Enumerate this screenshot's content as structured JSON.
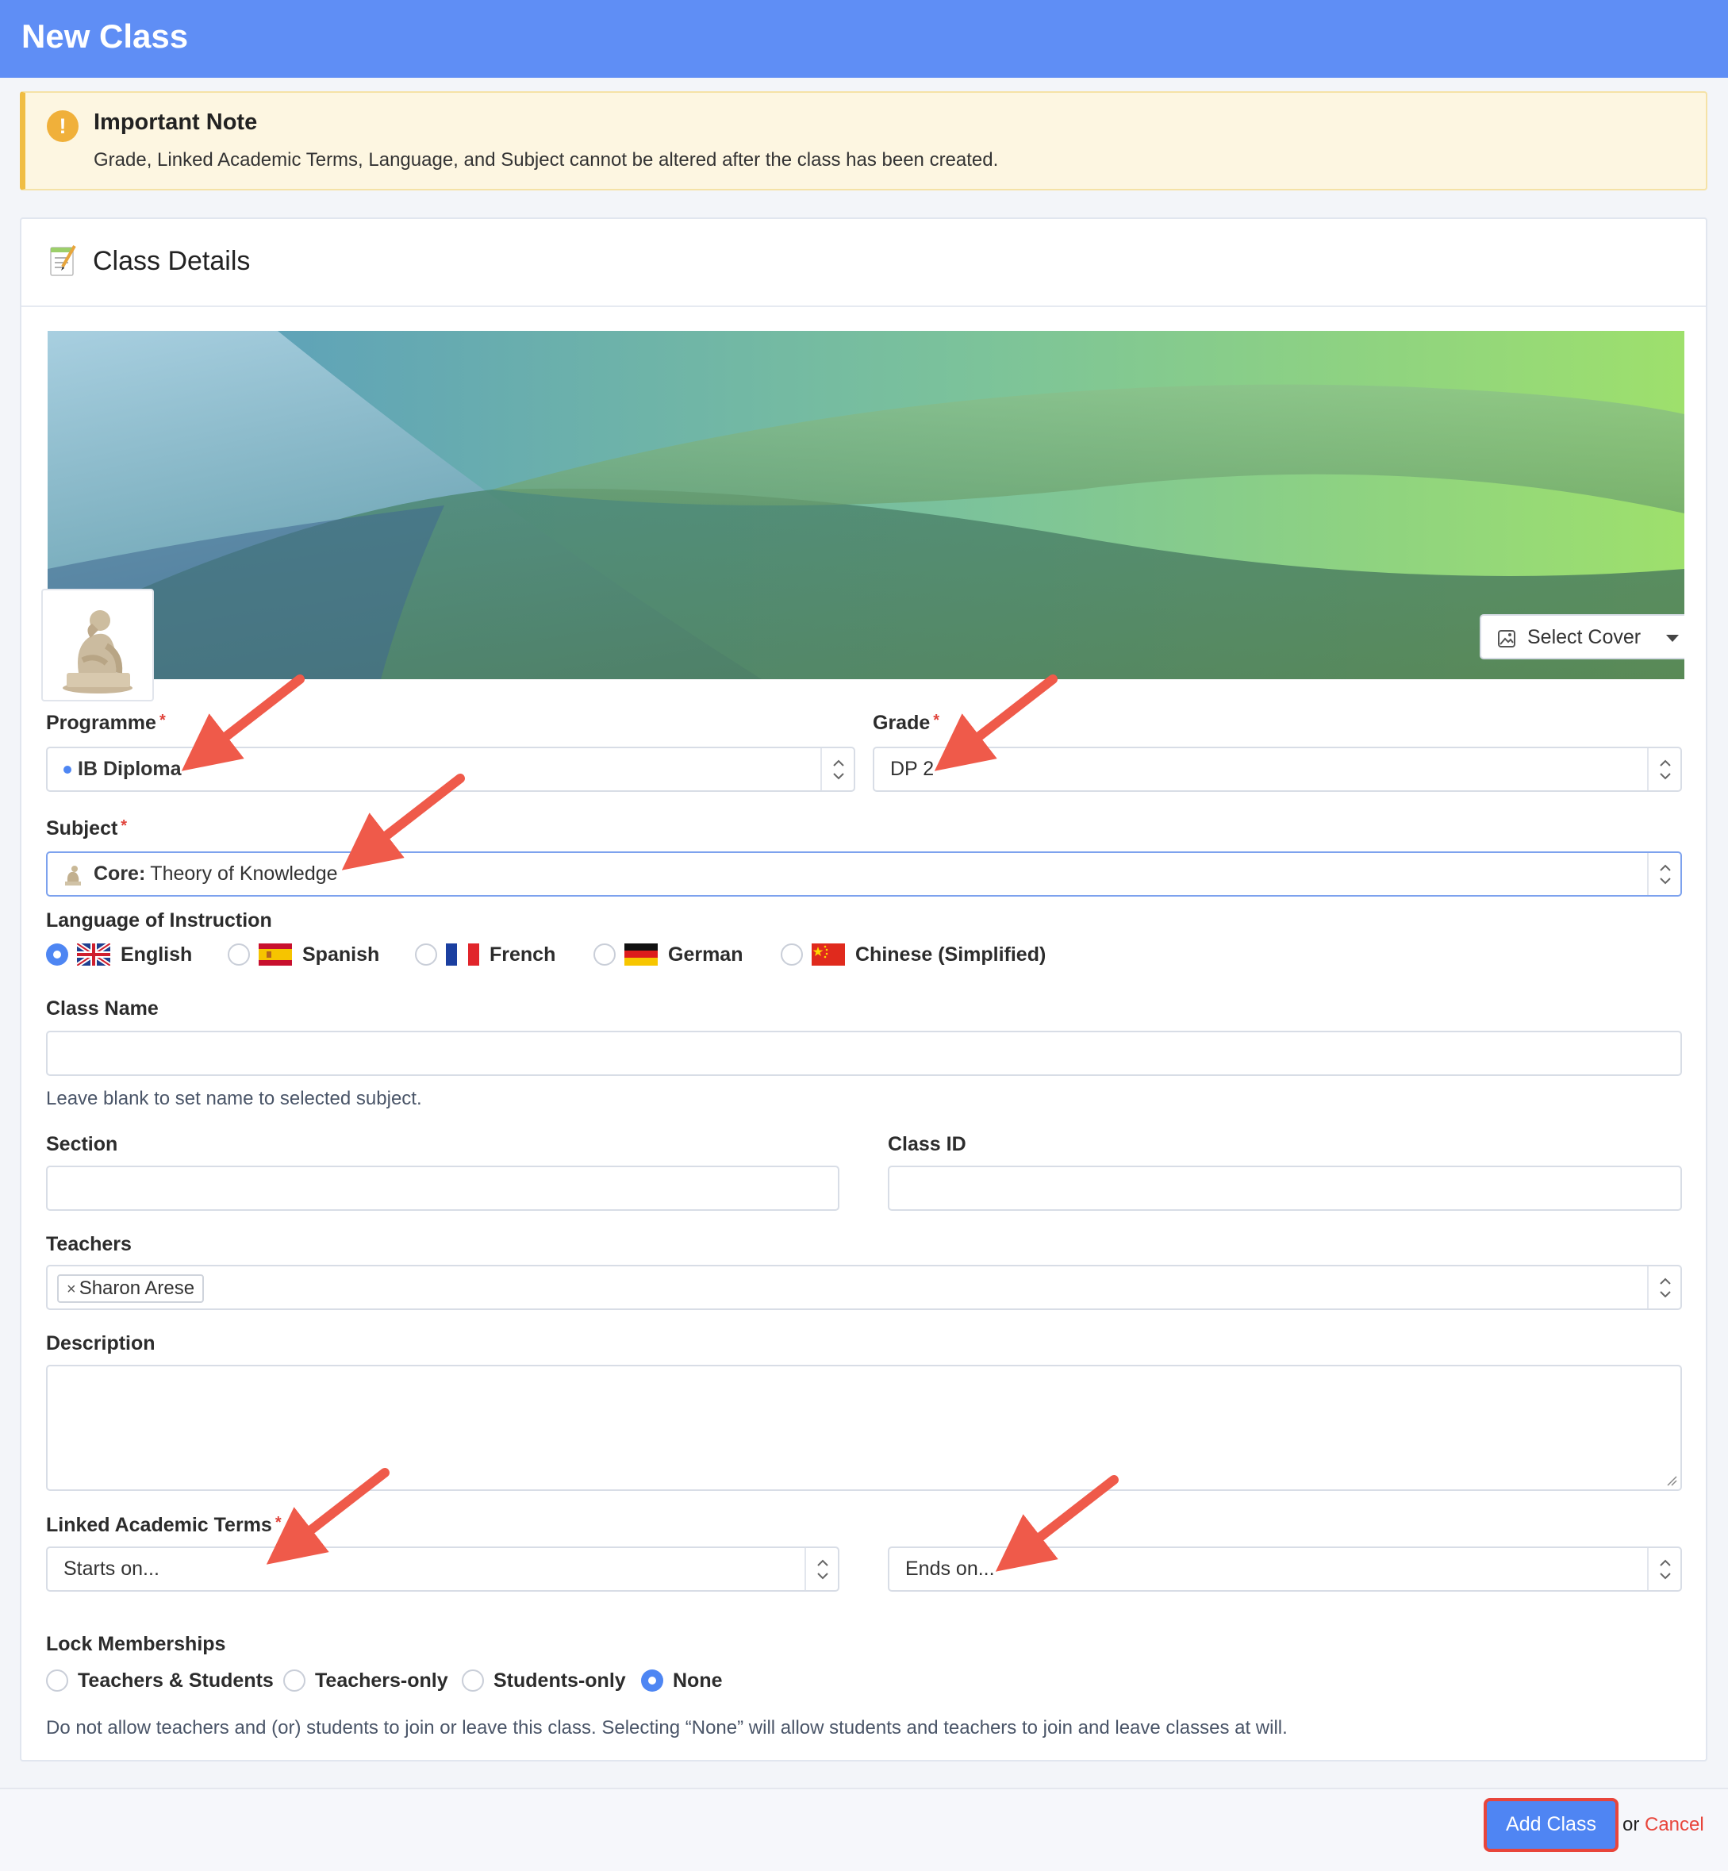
{
  "header": {
    "title": "New Class"
  },
  "note": {
    "icon": "exclamation-icon",
    "title": "Important Note",
    "text": "Grade, Linked Academic Terms, Language, and Subject cannot be altered after the class has been created."
  },
  "card": {
    "title": "Class Details",
    "icon": "memo-icon",
    "cover_button": "Select Cover"
  },
  "form": {
    "programme": {
      "label": "Programme",
      "required_mark": "*",
      "value": "IB Diploma"
    },
    "grade": {
      "label": "Grade",
      "required_mark": "*",
      "value": "DP 2"
    },
    "subject": {
      "label": "Subject",
      "required_mark": "*",
      "prefix": "Core:",
      "value": "Theory of Knowledge"
    },
    "language": {
      "label": "Language of Instruction",
      "options": [
        "English",
        "Spanish",
        "French",
        "German",
        "Chinese (Simplified)"
      ],
      "selected": "English"
    },
    "class_name": {
      "label": "Class Name",
      "value": "",
      "hint": "Leave blank to set name to selected subject."
    },
    "section": {
      "label": "Section",
      "value": ""
    },
    "class_id": {
      "label": "Class ID",
      "value": ""
    },
    "teachers": {
      "label": "Teachers",
      "tags": [
        "Sharon Arese"
      ],
      "remove_glyph": "×"
    },
    "description": {
      "label": "Description",
      "value": ""
    },
    "linked_terms": {
      "label": "Linked Academic Terms",
      "required_mark": "*",
      "start_placeholder": "Starts on...",
      "end_placeholder": "Ends on..."
    },
    "lock_memberships": {
      "label": "Lock Memberships",
      "options": [
        "Teachers & Students",
        "Teachers-only",
        "Students-only",
        "None"
      ],
      "selected": "None",
      "hint": "Do not allow teachers and (or) students to join or leave this class. Selecting “None” will allow students and teachers to join and leave classes at will."
    }
  },
  "footer": {
    "add_button": "Add Class",
    "or_text": "or",
    "cancel_link": "Cancel"
  },
  "colors": {
    "header_bg": "#5f8ef5",
    "note_bg": "#fdf6e1",
    "note_accent": "#f0bd43",
    "primary": "#4f85f3",
    "danger": "#e8453b",
    "programme_dot": "#4e86f3"
  }
}
